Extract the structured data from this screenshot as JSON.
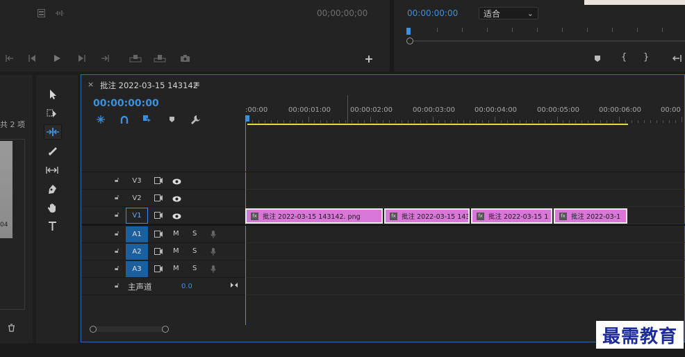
{
  "source_monitor": {
    "timecode": "00;00;00;00"
  },
  "program_monitor": {
    "timecode": "00:00:00:00",
    "fit_select": "适合",
    "fit_caret": "⌄"
  },
  "project_panel": {
    "item_count": "共 2 项",
    "thumb_label": "04"
  },
  "timeline": {
    "close_glyph": "×",
    "sequence_name": "批注 2022-03-15 143142",
    "menu_glyph": "≡",
    "timecode": "00:00:00:00",
    "ruler_labels": [
      ":00:00",
      "00:00:01:00",
      "00:00:02:00",
      "00:00:03:00",
      "00:00:04:00",
      "00:00:05:00",
      "00:00:06:00",
      "00:00"
    ],
    "video_tracks": [
      {
        "name": "V3",
        "target_on": false
      },
      {
        "name": "V2",
        "target_on": false
      },
      {
        "name": "V1",
        "target_on": true
      }
    ],
    "audio_tracks": [
      {
        "name": "A1",
        "m": "M",
        "s": "S"
      },
      {
        "name": "A2",
        "m": "M",
        "s": "S"
      },
      {
        "name": "A3",
        "m": "M",
        "s": "S"
      }
    ],
    "master": {
      "label": "主声道",
      "value": "0.0"
    },
    "clips": [
      {
        "label": "批注 2022-03-15  143142. png"
      },
      {
        "label": "批注 2022-03-15 143"
      },
      {
        "label": "批注 2022-03-15 1"
      },
      {
        "label": "批注 2022-03-1"
      }
    ],
    "fx_badge": "fx"
  },
  "watermark": "最需教育",
  "colors": {
    "accent_blue": "#3d8fe0",
    "clip_pink": "#d977d9",
    "work_area_yellow": "#e5d94a",
    "target_blue": "#1b5f9c"
  }
}
